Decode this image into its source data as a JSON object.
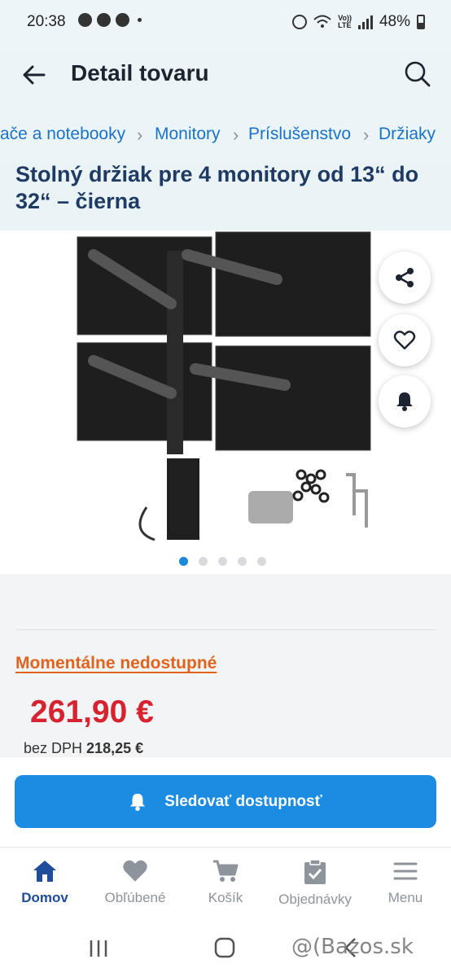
{
  "status": {
    "time": "20:38",
    "battery": "48%",
    "volte": "Vo))\nLTE"
  },
  "appbar": {
    "title": "Detail tovaru"
  },
  "breadcrumbs": [
    "ače a notebooky",
    "Monitory",
    "Príslušenstvo",
    "Držiaky"
  ],
  "product": {
    "title": "Stolný držiak pre 4 monitory od 13“ do 32“ – čierna",
    "availability": "Momentálne nedostupné",
    "price": "261,90 €",
    "vat_label": "bez DPH",
    "vat_price": "218,25 €"
  },
  "gallery": {
    "image_count": 5,
    "active_index": 0
  },
  "actions": {
    "notify_label": "Sledovať dostupnosť"
  },
  "bottom_nav": [
    {
      "label": "Domov",
      "icon": "home-icon",
      "active": true
    },
    {
      "label": "Obľúbené",
      "icon": "heart-icon",
      "active": false
    },
    {
      "label": "Košík",
      "icon": "cart-icon",
      "active": false
    },
    {
      "label": "Objednávky",
      "icon": "clipboard-icon",
      "active": false
    },
    {
      "label": "Menu",
      "icon": "menu-icon",
      "active": false
    }
  ],
  "watermark": "@(Bazos.sk",
  "colors": {
    "accent": "#1c8be2",
    "price": "#d6232f",
    "availability": "#e0641f",
    "title": "#1f3b64",
    "nav_active": "#1f4c9b"
  }
}
